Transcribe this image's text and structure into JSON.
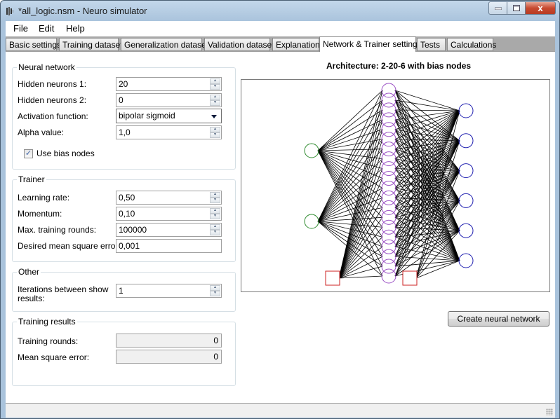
{
  "window": {
    "title": "*all_logic.nsm - Neuro simulator",
    "close_glyph": "x"
  },
  "menu": [
    "File",
    "Edit",
    "Help"
  ],
  "tabs": [
    {
      "label": "Basic settings",
      "active": false
    },
    {
      "label": "Training dataset",
      "active": false
    },
    {
      "label": "Generalization dataset",
      "active": false
    },
    {
      "label": "Validation dataset",
      "active": false
    },
    {
      "label": "Explanations",
      "active": false
    },
    {
      "label": "Network & Trainer settings",
      "active": true
    },
    {
      "label": "Tests",
      "active": false
    },
    {
      "label": "Calculations",
      "active": false
    }
  ],
  "neural_network": {
    "title": "Neural network",
    "hidden1_label": "Hidden neurons 1:",
    "hidden1_value": "20",
    "hidden2_label": "Hidden neurons 2:",
    "hidden2_value": "0",
    "activation_label": "Activation function:",
    "activation_value": "bipolar sigmoid",
    "alpha_label": "Alpha value:",
    "alpha_value": "1,0",
    "bias_label": "Use bias nodes",
    "bias_checked": true,
    "check_glyph": "✓"
  },
  "trainer": {
    "title": "Trainer",
    "learning_rate_label": "Learning rate:",
    "learning_rate_value": "0,50",
    "momentum_label": "Momentum:",
    "momentum_value": "0,10",
    "max_rounds_label": "Max. training rounds:",
    "max_rounds_value": "100000",
    "mse_label": "Desired mean square error:",
    "mse_value": "0,001"
  },
  "other": {
    "title": "Other",
    "iterations_label": "Iterations between show results:",
    "iterations_value": "1"
  },
  "training_results": {
    "title": "Training results",
    "rounds_label": "Training rounds:",
    "rounds_value": "0",
    "mse_label": "Mean square error:",
    "mse_value": "0"
  },
  "architecture": {
    "title": "Architecture: 2-20-6 with bias nodes",
    "inputs": 2,
    "hidden": 20,
    "outputs": 6,
    "bias_nodes": true,
    "colors": {
      "input": "#2e8b2e",
      "hidden": "#9a4fc4",
      "output": "#2020b0",
      "bias": "#cc2222",
      "connection": "#000000"
    }
  },
  "create_button": "Create neural network",
  "spin_up": "▲",
  "spin_down": "▼"
}
